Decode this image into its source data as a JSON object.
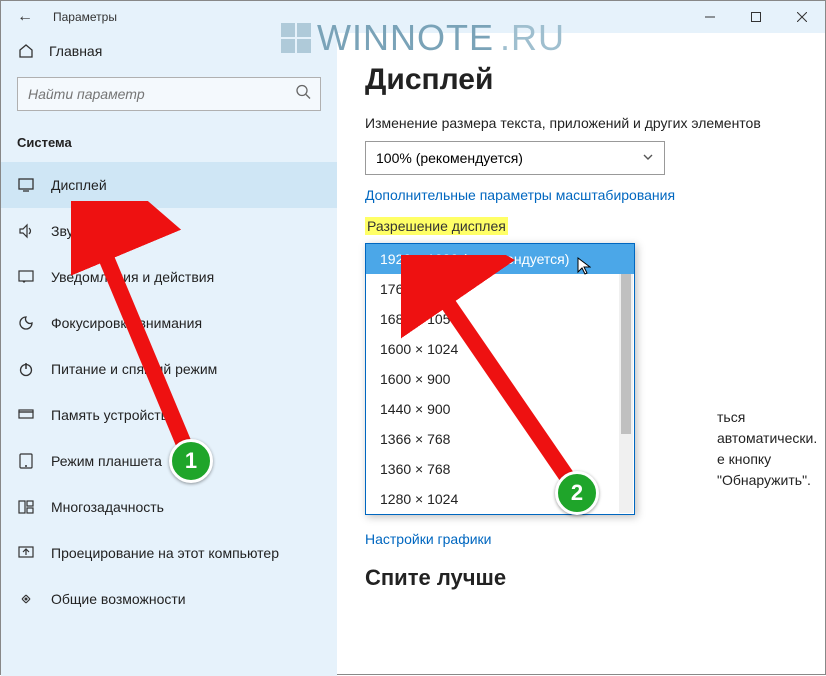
{
  "titlebar": {
    "title": "Параметры"
  },
  "watermark": {
    "a": "WINNOTE",
    "b": ".RU"
  },
  "sidebar": {
    "home_label": "Главная",
    "search_placeholder": "Найти параметр",
    "group_label": "Система",
    "items": [
      {
        "label": "Дисплей",
        "active": true
      },
      {
        "label": "Звук"
      },
      {
        "label": "Уведомления и действия"
      },
      {
        "label": "Фокусировка внимания"
      },
      {
        "label": "Питание и спящий режим"
      },
      {
        "label": "Память устройства"
      },
      {
        "label": "Режим планшета"
      },
      {
        "label": "Многозадачность"
      },
      {
        "label": "Проецирование на этот компьютер"
      },
      {
        "label": "Общие возможности"
      }
    ]
  },
  "main": {
    "page_title": "Дисплей",
    "scale_help": "Изменение размера текста, приложений и других элементов",
    "scale_value": "100% (рекомендуется)",
    "adv_scaling_link": "Дополнительные параметры масштабирования",
    "resolution_label": "Разрешение дисплея",
    "resolution_options": [
      "1920 × 1080 (рекомендуется)",
      "1768 × 992",
      "1680 × 1050",
      "1600 × 1024",
      "1600 × 900",
      "1440 × 900",
      "1366 × 768",
      "1360 × 768",
      "1280 × 1024"
    ],
    "detect_text_a": "ться автоматически.",
    "detect_text_b": "е кнопку \"Обнаружить\".",
    "graphics_link": "Настройки графики",
    "sleep_header": "Спите лучше"
  },
  "annotations": {
    "badge1": "1",
    "badge2": "2"
  }
}
